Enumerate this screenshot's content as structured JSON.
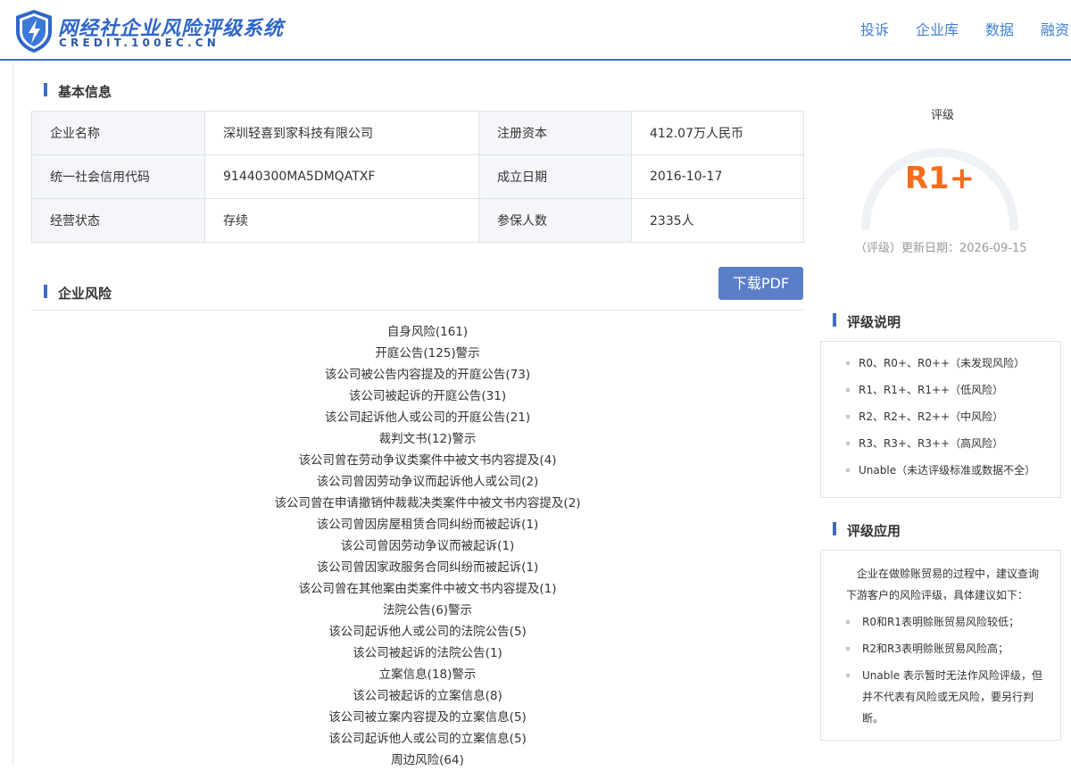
{
  "header": {
    "logo_title": "网经社企业风险评级系统",
    "logo_sub": "CREDIT.100EC.CN",
    "nav": [
      "投诉",
      "企业库",
      "数据",
      "融资"
    ]
  },
  "basic": {
    "title": "基本信息",
    "rows": [
      [
        "企业名称",
        "深圳轻喜到家科技有限公司",
        "注册资本",
        "412.07万人民币"
      ],
      [
        "统一社会信用代码",
        "91440300MA5DMQATXF",
        "成立日期",
        "2016-10-17"
      ],
      [
        "经营状态",
        "存续",
        "参保人数",
        "2335人"
      ]
    ]
  },
  "risk": {
    "title": "企业风险",
    "pdf_label": "下载PDF",
    "items": [
      "自身风险(161)",
      "开庭公告(125)警示",
      "该公司被公告内容提及的开庭公告(73)",
      "该公司被起诉的开庭公告(31)",
      "该公司起诉他人或公司的开庭公告(21)",
      "裁判文书(12)警示",
      "该公司曾在劳动争议类案件中被文书内容提及(4)",
      "该公司曾因劳动争议而起诉他人或公司(2)",
      "该公司曾在申请撤销仲裁裁决类案件中被文书内容提及(2)",
      "该公司曾因房屋租赁合同纠纷而被起诉(1)",
      "该公司曾因劳动争议而被起诉(1)",
      "该公司曾因家政服务合同纠纷而被起诉(1)",
      "该公司曾在其他案由类案件中被文书内容提及(1)",
      "法院公告(6)警示",
      "该公司起诉他人或公司的法院公告(5)",
      "该公司被起诉的法院公告(1)",
      "立案信息(18)警示",
      "该公司被起诉的立案信息(8)",
      "该公司被立案内容提及的立案信息(5)",
      "该公司起诉他人或公司的立案信息(5)",
      "周边风险(64)"
    ]
  },
  "rating": {
    "label": "评级",
    "grade": "R1+",
    "update": "（评级）更新日期：2026-09-15",
    "grade_color": "#f56c1d"
  },
  "legend": {
    "title": "评级说明",
    "items": [
      "R0、R0+、R0++（未发现风险）",
      "R1、R1+、R1++（低风险）",
      "R2、R2+、R2++（中风险）",
      "R3、R3+、R3++（高风险）",
      "Unable（未达评级标准或数据不全）"
    ]
  },
  "application": {
    "title": "评级应用",
    "intro": "企业在做赊账贸易的过程中，建议查询下游客户的风险评级，具体建议如下：",
    "items": [
      "R0和R1表明赊账贸易风险较低；",
      "R2和R3表明赊账贸易风险高；",
      "Unable 表示暂时无法作风险评级，但并不代表有风险或无风险，要另行判断。"
    ]
  },
  "colors": {
    "accent": "#3f6cc4",
    "link": "#3f7fd8",
    "button": "#5a7ec8"
  }
}
